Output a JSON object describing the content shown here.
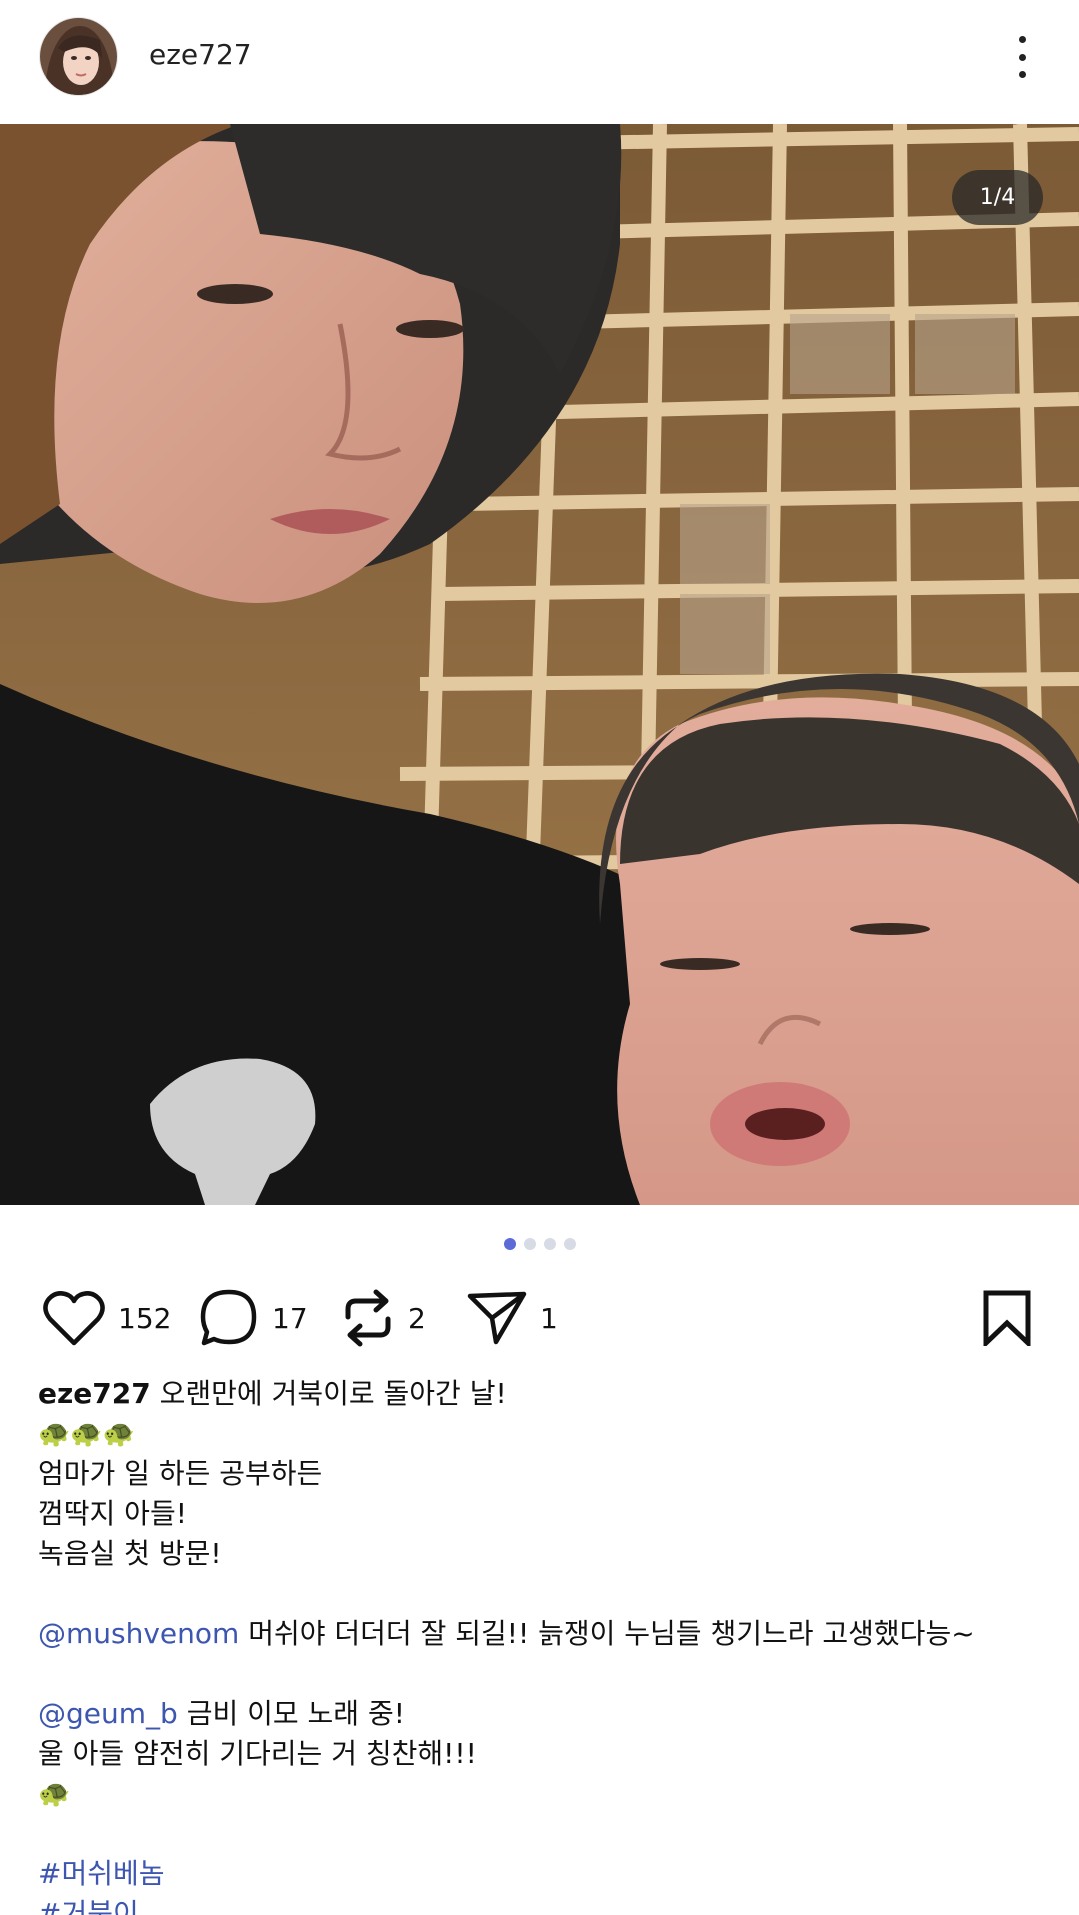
{
  "header": {
    "username": "eze727",
    "avatar_icon": "profile-avatar",
    "more_icon": "more-vertical-icon"
  },
  "media": {
    "counter": "1/4",
    "page_dots": 4,
    "active_dot": 0
  },
  "actions": {
    "likes": "152",
    "comments": "17",
    "reposts": "2",
    "shares": "1"
  },
  "caption": {
    "username": "eze727",
    "first_line": "오랜만에 거북이로 돌아간 날!",
    "emoji_row": "🐢🐢🐢",
    "line2": "엄마가 일 하든 공부하든",
    "line3": "껌딱지 아들!",
    "line4": "녹음실 첫 방문!",
    "mention1": "@mushvenom",
    "mention1_text": " 머쉬야 더더더 잘 되길!! 늙쟁이 누님들 챙기느라 고생했다능~",
    "mention2": "@geum_b",
    "mention2_text": " 금비 이모 노래 중!",
    "line5": "울 아들 얌전히 기다리는 거 칭찬해!!!",
    "emoji_single": "🐢",
    "hashtag1": "#머쉬베놈",
    "hashtag2": "#거북이"
  },
  "colors": {
    "accent": "#5c6bd6",
    "link": "#3d56b0",
    "counter_bg": "#282828"
  }
}
